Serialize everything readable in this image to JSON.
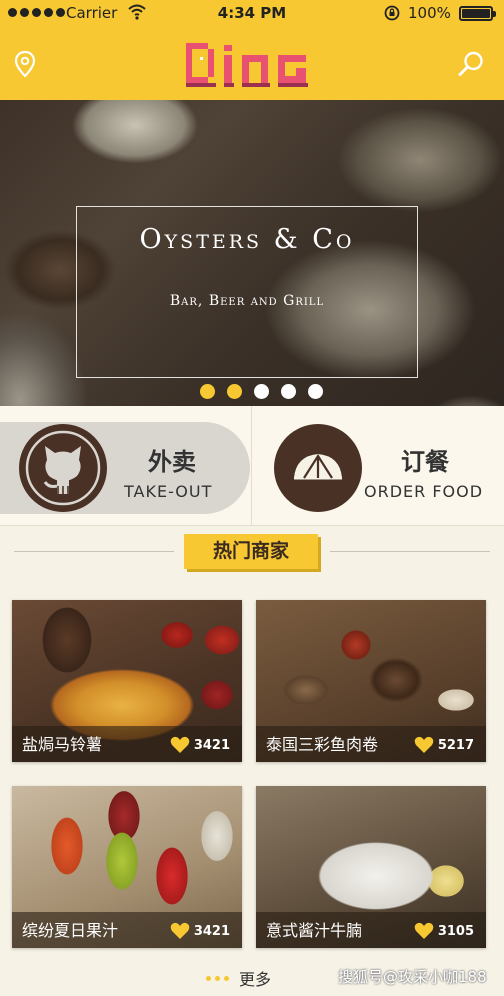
{
  "status_bar": {
    "carrier": "Carrier",
    "time": "4:34 PM",
    "battery": "100%"
  },
  "navbar": {
    "logo_text": "DiNG",
    "left_icon": "location-pin-icon",
    "right_icon": "search-icon"
  },
  "banner": {
    "title": "Oysters & Co",
    "subtitle": "Bar, Beer and Grill",
    "pages": 5,
    "active_page": [
      0,
      1
    ]
  },
  "services": [
    {
      "cn": "外卖",
      "en": "TAKE-OUT",
      "icon": "github-octocat-icon"
    },
    {
      "cn": "订餐",
      "en": "ORDER FOOD",
      "icon": "umbrella-dish-icon"
    }
  ],
  "section": {
    "title": "热门商家"
  },
  "cards": [
    {
      "name": "盐焗马铃薯",
      "likes": "3421"
    },
    {
      "name": "泰国三彩鱼肉卷",
      "likes": "5217"
    },
    {
      "name": "缤纷夏日果汁",
      "likes": "3421"
    },
    {
      "name": "意式酱汁牛腩",
      "likes": "3105"
    }
  ],
  "footer": {
    "more_label": "更多",
    "watermark": "搜狐号@玫采小咖188"
  },
  "colors": {
    "brand_yellow": "#f7c832",
    "dark_brown": "#4a3126",
    "background": "#f6f2e6"
  }
}
